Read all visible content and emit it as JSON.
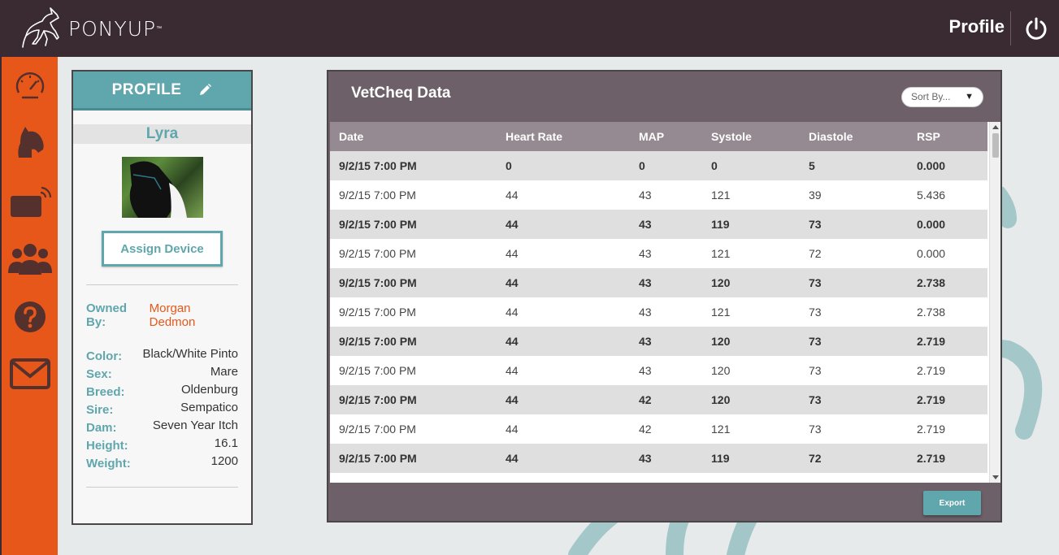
{
  "app": {
    "brand": "PONYUP",
    "brand_tm": "™",
    "page_title": "Profile"
  },
  "sidebar": {
    "items": [
      {
        "icon": "speedometer-icon"
      },
      {
        "icon": "horse-head-icon"
      },
      {
        "icon": "wireless-device-icon"
      },
      {
        "icon": "users-group-icon"
      },
      {
        "icon": "help-icon"
      },
      {
        "icon": "mail-icon"
      }
    ]
  },
  "profile": {
    "header": "PROFILE",
    "name": "Lyra",
    "assign_label": "Assign Device",
    "owner_label": "Owned By:",
    "owner_name": "Morgan Dedmon",
    "attributes": [
      {
        "label": "Color:",
        "value": "Black/White Pinto"
      },
      {
        "label": "Sex:",
        "value": "Mare"
      },
      {
        "label": "Breed:",
        "value": "Oldenburg"
      },
      {
        "label": "Sire:",
        "value": "Sempatico"
      },
      {
        "label": "Dam:",
        "value": "Seven Year Itch"
      },
      {
        "label": "Height:",
        "value": "16.1"
      },
      {
        "label": "Weight:",
        "value": "1200"
      }
    ]
  },
  "vetcheq": {
    "title": "VetCheq Data",
    "sort_placeholder": "Sort By...",
    "columns": [
      "Date",
      "Heart Rate",
      "MAP",
      "Systole",
      "Diastole",
      "RSP"
    ],
    "rows": [
      [
        "9/2/15 7:00 PM",
        "0",
        "0",
        "0",
        "5",
        "0.000"
      ],
      [
        "9/2/15 7:00 PM",
        "44",
        "43",
        "121",
        "39",
        "5.436"
      ],
      [
        "9/2/15 7:00 PM",
        "44",
        "43",
        "119",
        "73",
        "0.000"
      ],
      [
        "9/2/15 7:00 PM",
        "44",
        "43",
        "121",
        "72",
        "0.000"
      ],
      [
        "9/2/15 7:00 PM",
        "44",
        "43",
        "120",
        "73",
        "2.738"
      ],
      [
        "9/2/15 7:00 PM",
        "44",
        "43",
        "121",
        "73",
        "2.738"
      ],
      [
        "9/2/15 7:00 PM",
        "44",
        "43",
        "120",
        "73",
        "2.719"
      ],
      [
        "9/2/15 7:00 PM",
        "44",
        "43",
        "120",
        "73",
        "2.719"
      ],
      [
        "9/2/15 7:00 PM",
        "44",
        "42",
        "120",
        "73",
        "2.719"
      ],
      [
        "9/2/15 7:00 PM",
        "44",
        "42",
        "121",
        "73",
        "2.719"
      ],
      [
        "9/2/15 7:00 PM",
        "44",
        "43",
        "119",
        "72",
        "2.719"
      ]
    ],
    "export_label": "Export"
  },
  "colors": {
    "topbar": "#3a2a31",
    "sidebar": "#e8571a",
    "accent_teal": "#5fa6ad",
    "panel": "#6d6068",
    "owner_name": "#e8571a"
  }
}
